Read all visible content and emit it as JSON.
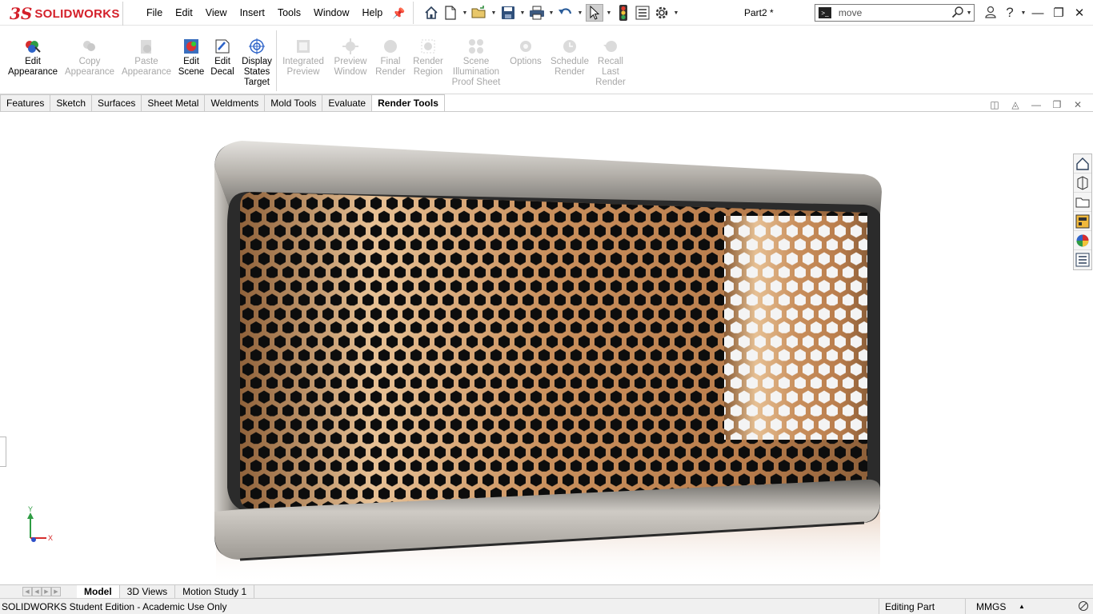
{
  "app": {
    "brand_ds": "3S",
    "brand_name": "SOLIDWORKS",
    "document_title": "Part2 *"
  },
  "menu": [
    "File",
    "Edit",
    "View",
    "Insert",
    "Tools",
    "Window",
    "Help"
  ],
  "search": {
    "value": "move"
  },
  "ribbon": {
    "tools": [
      {
        "label1": "Edit",
        "label2": "Appearance",
        "label3": "",
        "icon": "edit-appearance-icon",
        "enabled": true
      },
      {
        "label1": "Copy",
        "label2": "Appearance",
        "label3": "",
        "icon": "copy-appearance-icon",
        "enabled": false
      },
      {
        "label1": "Paste",
        "label2": "Appearance",
        "label3": "",
        "icon": "paste-appearance-icon",
        "enabled": false
      },
      {
        "label1": "Edit",
        "label2": "Scene",
        "label3": "",
        "icon": "edit-scene-icon",
        "enabled": true
      },
      {
        "label1": "Edit",
        "label2": "Decal",
        "label3": "",
        "icon": "edit-decal-icon",
        "enabled": true
      },
      {
        "label1": "Display",
        "label2": "States",
        "label3": "Target",
        "icon": "display-states-icon",
        "enabled": true
      },
      {
        "label1": "Integrated",
        "label2": "Preview",
        "label3": "",
        "icon": "integrated-preview-icon",
        "enabled": false
      },
      {
        "label1": "Preview",
        "label2": "Window",
        "label3": "",
        "icon": "preview-window-icon",
        "enabled": false
      },
      {
        "label1": "Final",
        "label2": "Render",
        "label3": "",
        "icon": "final-render-icon",
        "enabled": false
      },
      {
        "label1": "Render",
        "label2": "Region",
        "label3": "",
        "icon": "render-region-icon",
        "enabled": false
      },
      {
        "label1": "Scene",
        "label2": "Illumination",
        "label3": "Proof Sheet",
        "icon": "scene-illumination-icon",
        "enabled": false
      },
      {
        "label1": "Options",
        "label2": "",
        "label3": "",
        "icon": "options-icon",
        "enabled": false
      },
      {
        "label1": "Schedule",
        "label2": "Render",
        "label3": "",
        "icon": "schedule-render-icon",
        "enabled": false
      },
      {
        "label1": "Recall",
        "label2": "Last",
        "label3": "Render",
        "icon": "recall-last-render-icon",
        "enabled": false
      }
    ]
  },
  "tabs": [
    "Features",
    "Sketch",
    "Surfaces",
    "Sheet Metal",
    "Weldments",
    "Mold Tools",
    "Evaluate",
    "Render Tools"
  ],
  "active_tab": "Render Tools",
  "triad": {
    "y": "Y",
    "x": "X"
  },
  "bottom_tabs": [
    "Model",
    "3D Views",
    "Motion Study 1"
  ],
  "active_bottom_tab": "Model",
  "status": {
    "left": "SOLIDWORKS Student Edition - Academic Use Only",
    "mode": "Editing Part",
    "units": "MMGS"
  },
  "colors": {
    "brand_red": "#d4202a",
    "grille_copper": "#c58a58",
    "frame_steel": "#a4a09c",
    "accent_blue": "#2a74c8"
  }
}
